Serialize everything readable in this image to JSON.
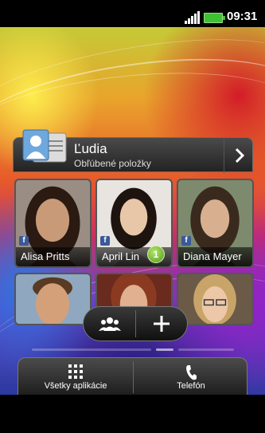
{
  "status_bar": {
    "time": "09:31",
    "signal_icon": "signal-bars-icon",
    "battery_icon": "battery-icon"
  },
  "people_widget": {
    "title": "Ľudia",
    "subtitle": "Obľúbené položky",
    "contacts": [
      {
        "name": "Alisa Pritts",
        "facebook": true,
        "badge": ""
      },
      {
        "name": "April Lin",
        "facebook": true,
        "badge": "1"
      },
      {
        "name": "Diana Mayer",
        "facebook": true,
        "badge": ""
      },
      {
        "name": "",
        "facebook": false,
        "badge": ""
      },
      {
        "name": "",
        "facebook": false,
        "badge": ""
      },
      {
        "name": "",
        "facebook": false,
        "badge": ""
      }
    ],
    "facebook_letter": "f"
  },
  "dock": {
    "all_apps_label": "Všetky aplikácie",
    "phone_label": "Telefón"
  },
  "colors": {
    "accent_green": "#3fc22f",
    "facebook_blue": "#3b5998"
  }
}
